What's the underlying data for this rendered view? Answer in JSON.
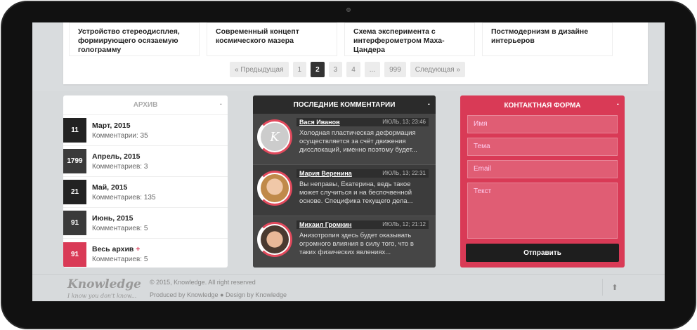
{
  "articles": [
    "Устройство стереодисплея, формирующего осязаемую голограмму",
    "Современный концепт космического мазера",
    "Схема эксперимента с интерферометром Маха-Цандера",
    "Постмодернизм в дизайне интерьеров"
  ],
  "pager": {
    "prev": "« Предыдущая",
    "p1": "1",
    "p2": "2",
    "p3": "3",
    "p4": "4",
    "dots": "...",
    "last": "999",
    "next": "Следующая »"
  },
  "archive": {
    "title": "АРХИВ",
    "min": "-",
    "items": [
      {
        "num": "11",
        "month": "Март, 2015",
        "comments": "Комментарии: 35"
      },
      {
        "num": "1799",
        "month": "Апрель, 2015",
        "comments": "Комментариев: 3"
      },
      {
        "num": "21",
        "month": "Май, 2015",
        "comments": "Комментариев: 135"
      },
      {
        "num": "91",
        "month": "Июнь, 2015",
        "comments": "Комментариев: 5"
      },
      {
        "num": "91",
        "month": "Весь архив",
        "plus": "+",
        "comments": "Комментариев: 5"
      }
    ]
  },
  "comments": {
    "title": "ПОСЛЕДНИЕ КОММЕНТАРИИ",
    "min": "-",
    "items": [
      {
        "avatar": "K",
        "name": "Вася Иванов",
        "date": "ИЮЛЬ, 13; 23:46",
        "text": "Холодная пластическая деформация осуществляется за счёт движения дисслокаций, именно поэтому будет..."
      },
      {
        "avatar": "",
        "name": "Мария Веренина",
        "date": "ИЮЛЬ, 13; 22:31",
        "text": "Вы неправы, Екатерина, ведь такое может случиться и на беспочвенной основе. Специфика текущего дела..."
      },
      {
        "avatar": "",
        "name": "Михаил Громкин",
        "date": "ИЮЛЬ, 12; 21:12",
        "text": "Анизотропия здесь будет оказывать огромного влияния в силу того, что в таких физических явлениях..."
      }
    ]
  },
  "contact": {
    "title": "КОНТАКТНАЯ ФОРМА",
    "min": "-",
    "name_ph": "Имя",
    "topic_ph": "Тема",
    "email_ph": "Email",
    "text_ph": "Текст",
    "send": "Отправить"
  },
  "footer": {
    "logo": "Knowledge",
    "slogan": "I know you don't know...",
    "copy": "© 2015, Knowledge. All right reserved",
    "produced": "Produced by Knowledge ● Design by Knowledge",
    "up": "⬆"
  },
  "colors": {
    "accent": "#d93a56",
    "dark": "#3c3c3c"
  }
}
